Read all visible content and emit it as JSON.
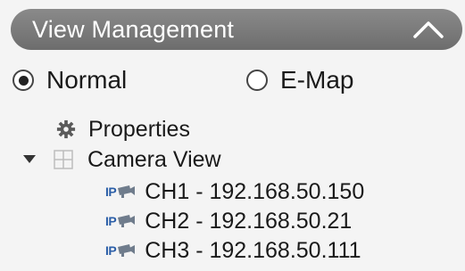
{
  "panel": {
    "title": "View Management",
    "collapse_icon": "chevron-up-icon"
  },
  "mode": {
    "options": [
      {
        "label": "Normal",
        "selected": true
      },
      {
        "label": "E-Map",
        "selected": false
      }
    ]
  },
  "tree": {
    "properties": {
      "label": "Properties",
      "icon": "gear-icon"
    },
    "camera_view": {
      "label": "Camera View",
      "icon": "grid-icon",
      "expanded": true
    },
    "channels": [
      {
        "label": "CH1 - 192.168.50.150",
        "icon_text": "IP"
      },
      {
        "label": "CH2 - 192.168.50.21",
        "icon_text": "IP"
      },
      {
        "label": "CH3 - 192.168.50.111",
        "icon_text": "IP"
      }
    ]
  },
  "colors": {
    "header_bg": "#7a7a7a",
    "ip_badge": "#2c5fa8",
    "camera_icon": "#6f7c8c"
  }
}
